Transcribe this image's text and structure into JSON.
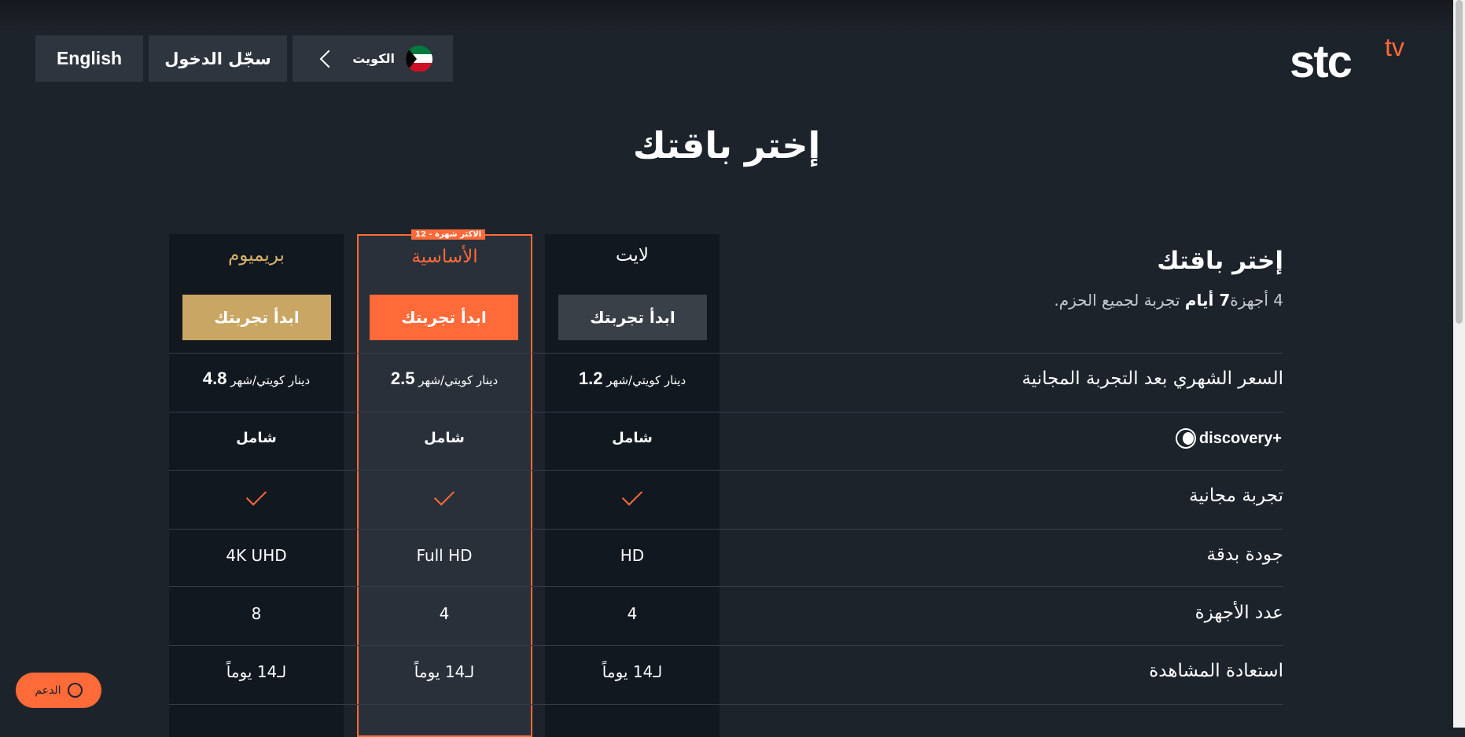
{
  "header": {
    "english_label": "English",
    "login_label": "سجّل الدخول",
    "country_label": "الكويت",
    "logo": {
      "brand": "stc",
      "suffix": "tv"
    }
  },
  "page_title": "إختر باقتك",
  "comparison": {
    "heading": "إختر باقتك",
    "note_prefix": "4 أجهزة",
    "note_days": "7 أيام",
    "note_suffix": " تجربة لجميع الحزم.",
    "rows": {
      "monthly_price": "السعر الشهري بعد التجربة المجانية",
      "discovery": "discovery+",
      "free_trial": "تجربة مجانية",
      "quality": "جودة بدقة",
      "devices": "عدد الأجهزة",
      "catchup": "استعادة المشاهدة"
    },
    "plans": [
      {
        "name": "بريميوم",
        "name_color": "#d8b36a",
        "button_label": "ابدأ تجربتك",
        "button_color": "#c9a663",
        "price_value": "4.8",
        "price_unit": "دينار كويتي/شهر",
        "discovery": "شامل",
        "quality": "4K UHD",
        "devices": "8",
        "catchup": "لـ14 يوماً"
      },
      {
        "name": "الأساسية",
        "name_color": "#ff6a39",
        "badge": "12 - الاكثر شهرة",
        "button_label": "ابدأ تجربتك",
        "button_color": "#ff6a39",
        "price_value": "2.5",
        "price_unit": "دينار كويتي/شهر",
        "discovery": "شامل",
        "quality": "Full HD",
        "devices": "4",
        "catchup": "لـ14 يوماً"
      },
      {
        "name": "لايت",
        "name_color": "#ffffff",
        "button_label": "ابدأ تجربتك",
        "button_color": "#3a4048",
        "price_value": "1.2",
        "price_unit": "دينار كويتي/شهر",
        "discovery": "شامل",
        "quality": "HD",
        "devices": "4",
        "catchup": "لـ14 يوماً"
      }
    ]
  },
  "support": {
    "label": "الدعم"
  },
  "colors": {
    "accent": "#ff6a39",
    "background": "#1d232b",
    "gold": "#c9a663"
  }
}
